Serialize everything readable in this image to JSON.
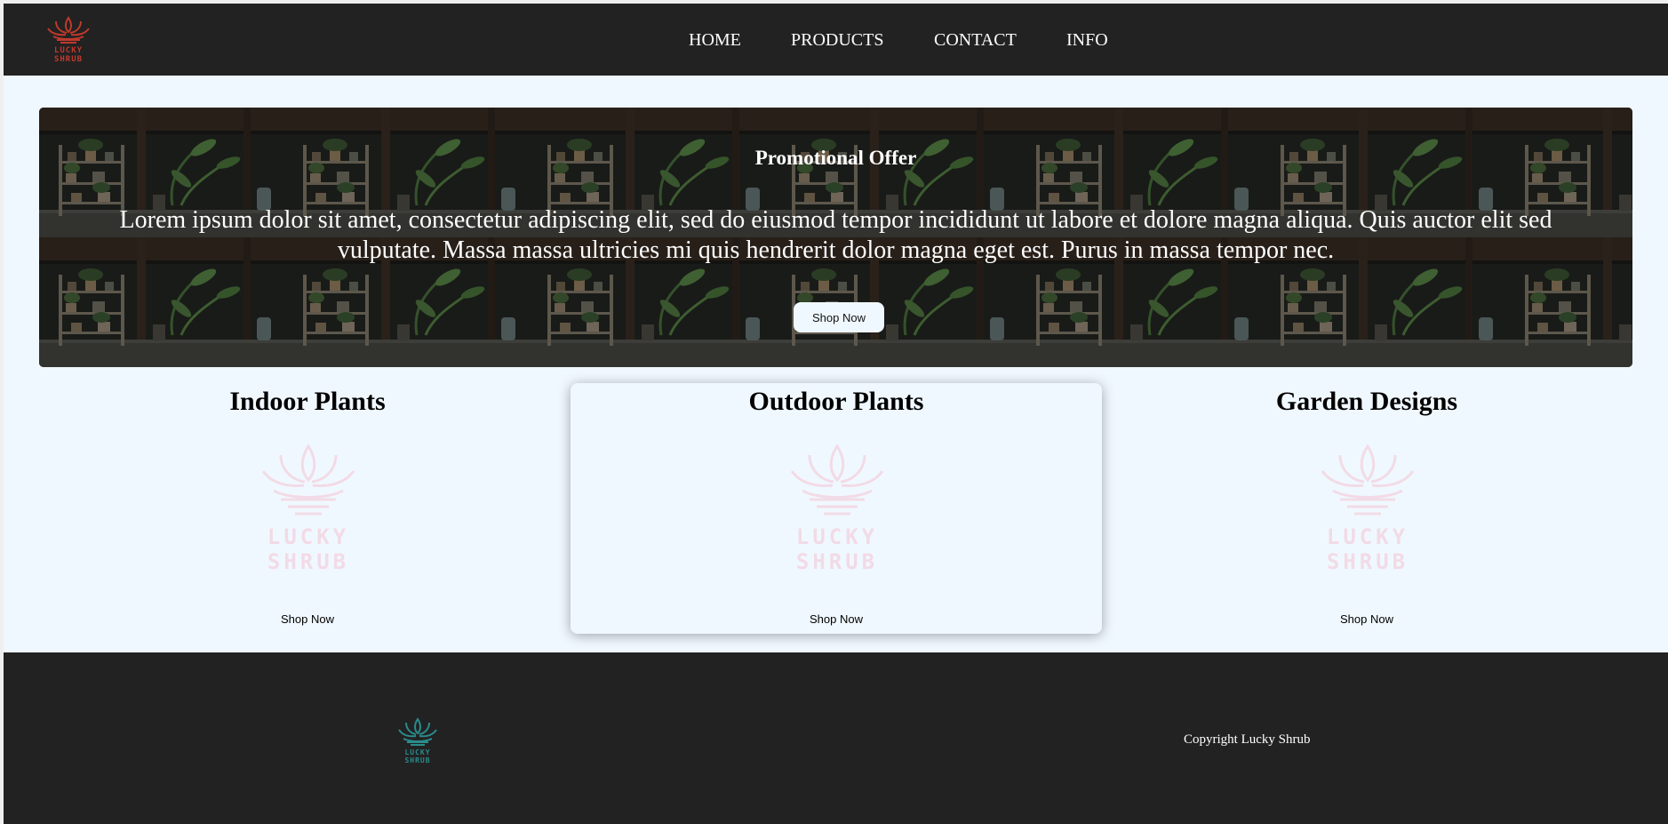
{
  "brand": {
    "name": "Lucky Shrub",
    "logo_word1": "LUCKY",
    "logo_word2": "SHRUB",
    "logo_colors": {
      "header": "#c0392b",
      "footer": "#2a8c8c",
      "watermark": "#f2dbe6"
    }
  },
  "colors": {
    "header_bg": "#222222",
    "page_bg": "#f0f8ff",
    "text_light": "#ffffff"
  },
  "nav": {
    "items": [
      {
        "label": "HOME"
      },
      {
        "label": "PRODUCTS"
      },
      {
        "label": "CONTACT"
      },
      {
        "label": "INFO"
      }
    ]
  },
  "hero": {
    "title": "Promotional Offer",
    "body": "Lorem ipsum dolor sit amet, consectetur adipiscing elit, sed do eiusmod tempor incididunt ut labore et dolore magna aliqua. Quis auctor elit sed vulputate. Massa massa ultricies mi quis hendrerit dolor magna eget est. Purus in massa tempor nec.",
    "button_label": "Shop Now"
  },
  "categories": [
    {
      "title": "Indoor Plants",
      "button_label": "Shop Now"
    },
    {
      "title": "Outdoor Plants",
      "button_label": "Shop Now"
    },
    {
      "title": "Garden Designs",
      "button_label": "Shop Now"
    }
  ],
  "footer": {
    "copyright": "Copyright Lucky Shrub"
  }
}
